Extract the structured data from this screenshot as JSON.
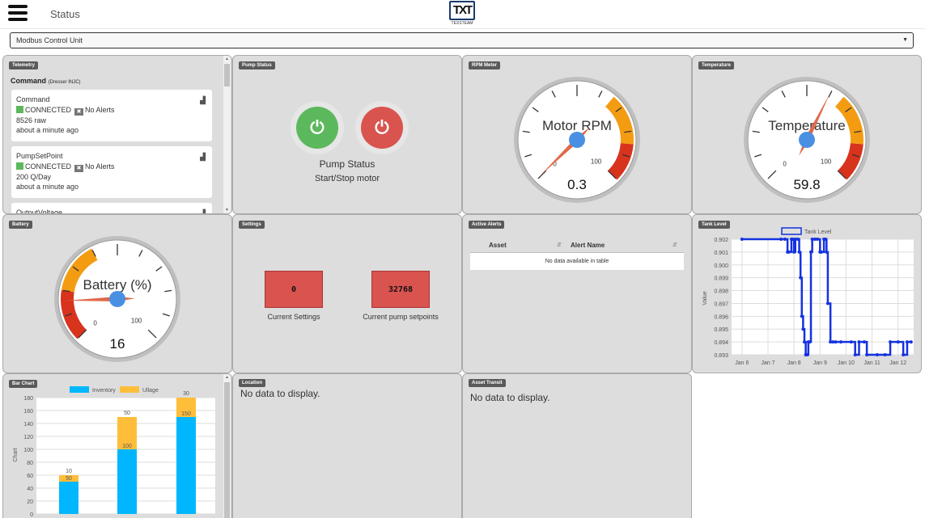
{
  "header": {
    "title": "Status",
    "logo_text": "TXT",
    "logo_sub": "TEXSTEAM"
  },
  "selector": {
    "value": "Modbus Control Unit",
    "caret": "▼"
  },
  "telemetry": {
    "title": "Telemetry",
    "head": "Command",
    "head_sub": "(Dresser INJC)",
    "cards": [
      {
        "name": "Command",
        "status": "CONNECTED",
        "alerts": "No Alerts",
        "value": "8526 raw",
        "time": "about a minute ago"
      },
      {
        "name": "PumpSetPoint",
        "status": "CONNECTED",
        "alerts": "No Alerts",
        "value": "200 Q/Day",
        "time": "about a minute ago"
      },
      {
        "name": "OutputVoltage"
      }
    ]
  },
  "pump": {
    "title": "Pump Status",
    "label": "Pump Status",
    "sub": "Start/Stop motor",
    "on_color": "#5cb85c",
    "off_color": "#d9534f"
  },
  "rpm": {
    "title": "RPM Meter",
    "label": "Motor RPM",
    "value": "0.3",
    "min": "0",
    "max": "100",
    "level": 0.3
  },
  "temperature": {
    "title": "Temperature",
    "label": "Temperature",
    "value": "59.8",
    "min": "0",
    "max": "100",
    "level": 59.8
  },
  "battery": {
    "title": "Battery",
    "label": "Battery (%)",
    "value": "16",
    "min": "0",
    "max": "100",
    "level": 16
  },
  "settings": {
    "title": "Settings",
    "current": "0",
    "current_label": "Current Settings",
    "setpoint": "32768",
    "setpoint_label": "Current pump setpoints"
  },
  "alerts": {
    "title": "Active Alerts",
    "col_asset": "Asset",
    "col_name": "Alert Name",
    "empty": "No data available in table"
  },
  "location": {
    "title": "Location",
    "empty": "No data to display."
  },
  "transit": {
    "title": "Asset Transit",
    "empty": "No data to display."
  },
  "tank_title": "Tank Level",
  "bar_title": "Bar Chart",
  "chart_data": [
    {
      "type": "line",
      "legend": "Tank Level",
      "ylabel": "Value",
      "ylim": [
        0.893,
        0.902
      ],
      "yticks": [
        "0.902",
        "0.901",
        "0.900",
        "0.899",
        "0.898",
        "0.897",
        "0.896",
        "0.895",
        "0.894",
        "0.893"
      ],
      "xticks": [
        "Jan 6",
        "Jan 7",
        "Jan 8",
        "Jan 9",
        "Jan 10",
        "Jan 11",
        "Jan 12"
      ],
      "series": [
        {
          "x": [
            6.0,
            7.5,
            7.65,
            7.75,
            7.8,
            7.9,
            7.95,
            8.0,
            8.05,
            8.15,
            8.2,
            8.25,
            8.3,
            8.35,
            8.4,
            8.45,
            8.5,
            8.55,
            8.6,
            8.65,
            8.7,
            8.8,
            8.9,
            9.0,
            9.05,
            9.15,
            9.2,
            9.25,
            9.3,
            9.4,
            9.5,
            9.6,
            9.8,
            10.2,
            10.35,
            10.5,
            10.7,
            10.8,
            11.2,
            11.5,
            11.7,
            12.0,
            12.2,
            12.35,
            12.5
          ],
          "y": [
            0.902,
            0.902,
            0.902,
            0.901,
            0.901,
            0.902,
            0.902,
            0.901,
            0.902,
            0.902,
            0.901,
            0.899,
            0.896,
            0.895,
            0.894,
            0.893,
            0.893,
            0.894,
            0.894,
            0.901,
            0.902,
            0.902,
            0.902,
            0.901,
            0.901,
            0.902,
            0.902,
            0.901,
            0.897,
            0.894,
            0.894,
            0.894,
            0.894,
            0.894,
            0.893,
            0.894,
            0.894,
            0.893,
            0.893,
            0.893,
            0.894,
            0.894,
            0.893,
            0.894,
            0.894
          ]
        }
      ]
    },
    {
      "type": "bar",
      "stacked": true,
      "ylabel": "Chart",
      "ylim": [
        0,
        180
      ],
      "yticks": [
        "180",
        "160",
        "140",
        "120",
        "100",
        "80",
        "60",
        "40",
        "20",
        "0"
      ],
      "categories": [
        "",
        "",
        ""
      ],
      "series": [
        {
          "name": "Inventory",
          "color": "#00b7ff",
          "values": [
            50,
            100,
            150
          ],
          "labels": [
            "50",
            "100",
            "150"
          ]
        },
        {
          "name": "Ullage",
          "color": "#ffbe3a",
          "values": [
            10,
            50,
            30
          ],
          "labels": [
            "10",
            "50",
            "30"
          ]
        }
      ]
    }
  ]
}
